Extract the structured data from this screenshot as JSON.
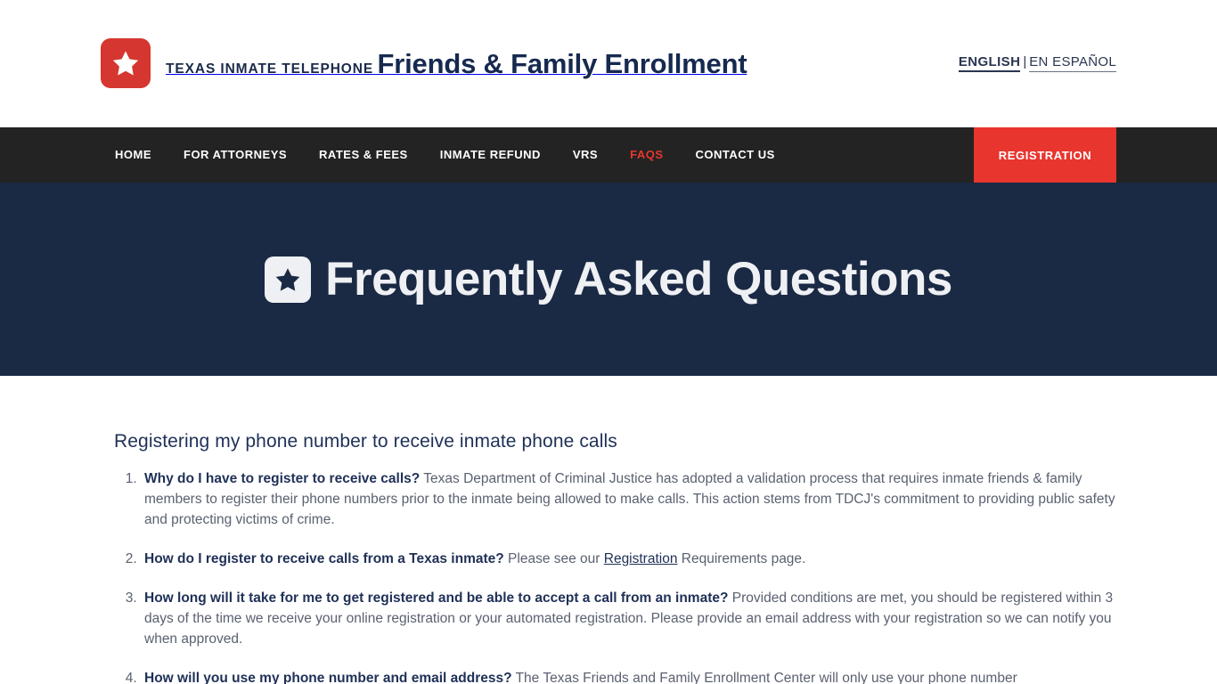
{
  "header": {
    "logo": {
      "icon": "star-badge-icon",
      "eyebrow": "TEXAS INMATE TELEPHONE",
      "title": "Friends & Family Enrollment",
      "brand_red": "#d5362f",
      "brand_navy": "#16294f"
    },
    "language": {
      "active": "ENGLISH",
      "separator": "|",
      "alternate": "EN ESPAÑOL"
    }
  },
  "nav": {
    "items": [
      {
        "label": "HOME",
        "active": false
      },
      {
        "label": "FOR ATTORNEYS",
        "active": false
      },
      {
        "label": "RATES & FEES",
        "active": false
      },
      {
        "label": "INMATE REFUND",
        "active": false
      },
      {
        "label": "VRS",
        "active": false
      },
      {
        "label": "FAQS",
        "active": true
      },
      {
        "label": "CONTACT US",
        "active": false
      }
    ],
    "cta_label": "REGISTRATION",
    "bar_color": "#232323",
    "accent_color": "#e8352e"
  },
  "hero": {
    "icon": "star-badge-icon",
    "title": "Frequently Asked Questions",
    "background": "#1a2944"
  },
  "main": {
    "section_heading": "Registering my phone number to receive inmate phone calls",
    "faqs": [
      {
        "question": "Why do I have to register to receive calls?",
        "answer_before": " Texas Department of Criminal Justice has adopted a validation process that requires inmate friends & family members to register their phone numbers prior to the inmate being allowed to make calls. This action stems from TDCJ's commitment to providing public safety and protecting victims of crime.",
        "link": "",
        "answer_after": ""
      },
      {
        "question": "How do I register to receive calls from a Texas inmate?",
        "answer_before": " Please see our ",
        "link": "Registration",
        "answer_after": " Requirements page."
      },
      {
        "question": "How long will it take for me to get registered and be able to accept a call from an inmate?",
        "answer_before": " Provided conditions are met, you should be registered within 3 days of the time we receive your online registration or your automated registration. Please provide an email address with your registration so we can notify you when approved.",
        "link": "",
        "answer_after": ""
      },
      {
        "question": "How will you use my phone number and email address?",
        "answer_before": " The Texas Friends and Family Enrollment Center will only use your phone number",
        "link": "",
        "answer_after": ""
      }
    ]
  }
}
